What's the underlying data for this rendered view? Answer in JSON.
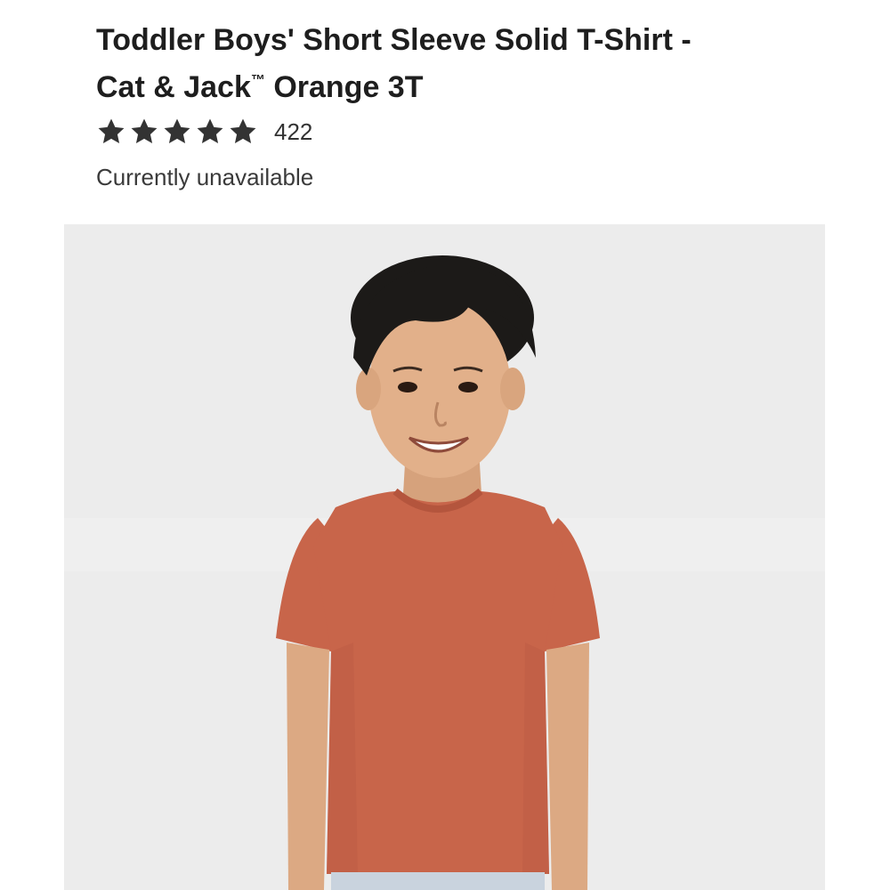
{
  "product": {
    "title_line1": "Toddler Boys' Short Sleeve Solid T-Shirt -",
    "title_line2_brand": "Cat & Jack",
    "title_tm": "™",
    "title_line2_rest": " Orange 3T",
    "rating": {
      "stars": 5,
      "max_stars": 5,
      "review_count": "422"
    },
    "availability": "Currently unavailable",
    "image": {
      "subject": "product-photo",
      "shirt_color": "#c8654a",
      "background_color": "#ececec"
    }
  },
  "colors": {
    "title": "#1e1e1e",
    "text": "#333333",
    "star": "#333333"
  }
}
